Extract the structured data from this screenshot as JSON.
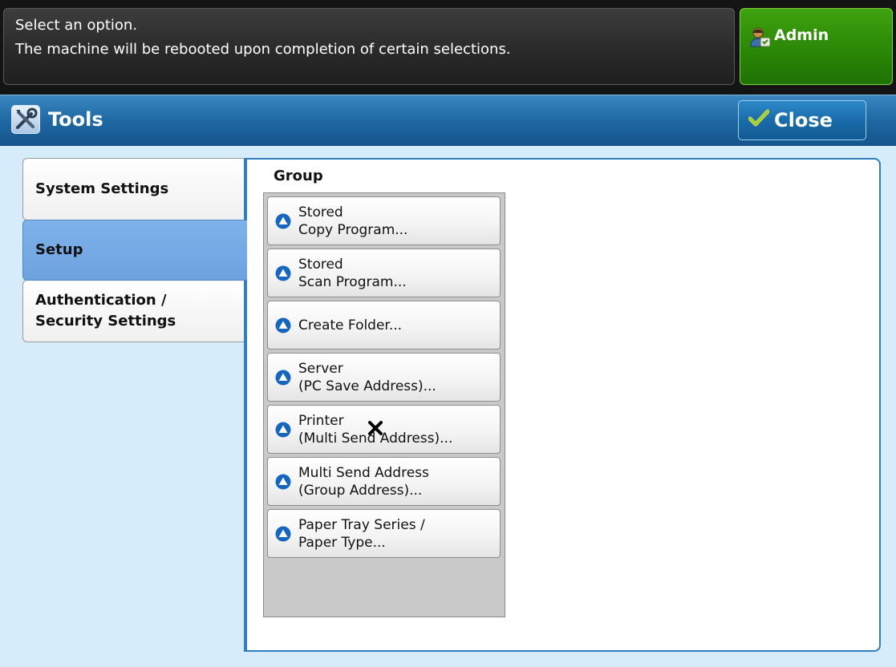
{
  "message": {
    "line1": "Select an option.",
    "line2": "The machine will be rebooted upon completion of certain selections."
  },
  "admin": {
    "label": "Admin",
    "icon": "admin-user-icon"
  },
  "header": {
    "title": "Tools",
    "icon": "tools-icon"
  },
  "close": {
    "label": "Close",
    "icon": "checkmark-icon"
  },
  "tabs": [
    {
      "line1": "System Settings",
      "line2": ""
    },
    {
      "line1": "Setup",
      "line2": ""
    },
    {
      "line1": "Authentication /",
      "line2": "Security Settings"
    }
  ],
  "group": {
    "label": "Group",
    "items": [
      {
        "line1": "Stored",
        "line2": "Copy Program..."
      },
      {
        "line1": "Stored",
        "line2": "Scan Program..."
      },
      {
        "line1": "Create Folder...",
        "line2": ""
      },
      {
        "line1": "Server",
        "line2": "(PC Save Address)..."
      },
      {
        "line1": "Printer",
        "line2": "(Multi Send Address)..."
      },
      {
        "line1": "Multi Send Address",
        "line2": "(Group Address)..."
      },
      {
        "line1": "Paper Tray Series /",
        "line2": "Paper Type..."
      }
    ]
  },
  "colors": {
    "header_blue": "#1f68a3",
    "admin_green": "#2c8a07",
    "active_tab": "#7fb2ea",
    "panel_border": "#2e7fc1"
  }
}
